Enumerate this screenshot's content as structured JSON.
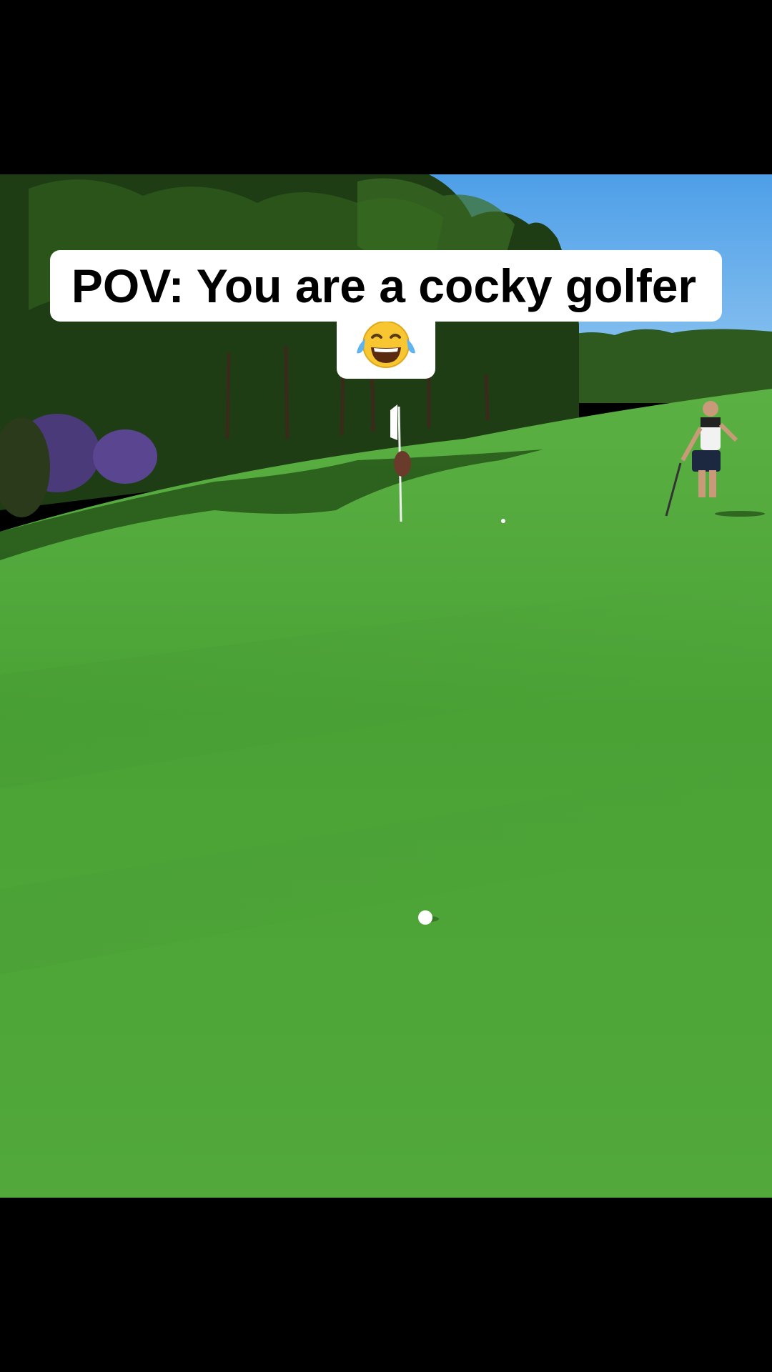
{
  "caption": {
    "line1": "POV: You are a cocky golfer",
    "emoji": "face-with-tears-of-joy"
  },
  "scene": {
    "description_icon": "golf-green-scene",
    "colors": {
      "letterbox": "#000000",
      "sky": "#5aa6ec",
      "grass": "#4fa63b",
      "grass_dark": "#3f8f2c",
      "trees": "#1f3d14",
      "caption_bg": "#ffffff",
      "caption_text": "#000000"
    }
  }
}
